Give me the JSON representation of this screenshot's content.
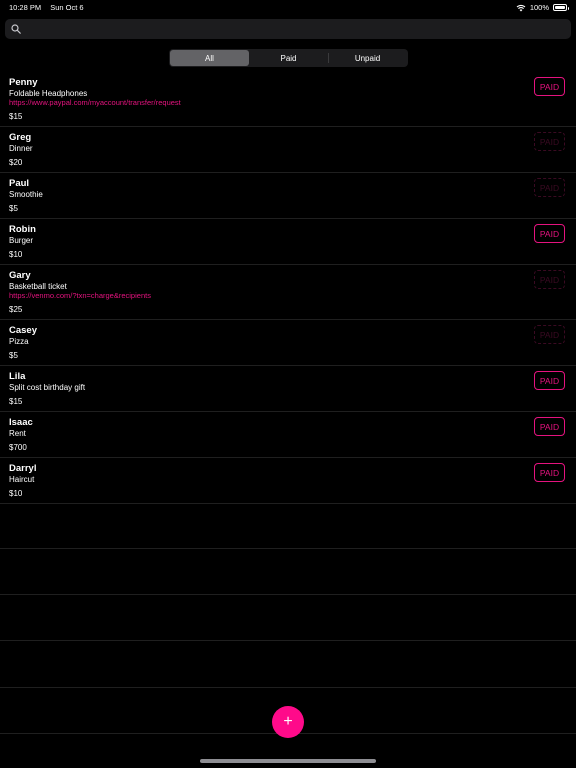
{
  "status": {
    "time": "10:28 PM",
    "date": "Sun Oct 6",
    "battery": "100%"
  },
  "search": {
    "placeholder": ""
  },
  "filter": {
    "options": [
      "All",
      "Paid",
      "Unpaid"
    ],
    "selected": "All"
  },
  "colors": {
    "accent": "#e5137f",
    "fab": "#ff0a8a",
    "background": "#000000"
  },
  "badge_label": "PAID",
  "requests": [
    {
      "name": "Penny",
      "description": "Foldable Headphones",
      "link": "https://www.paypal.com/myaccount/transfer/request",
      "amount": "$15",
      "paid": true
    },
    {
      "name": "Greg",
      "description": "Dinner",
      "link": "",
      "amount": "$20",
      "paid": false
    },
    {
      "name": "Paul",
      "description": "Smoothie",
      "link": "",
      "amount": "$5",
      "paid": false
    },
    {
      "name": "Robin",
      "description": "Burger",
      "link": "",
      "amount": "$10",
      "paid": true
    },
    {
      "name": "Gary",
      "description": "Basketball ticket",
      "link": "https://venmo.com/?txn=charge&recipients",
      "amount": "$25",
      "paid": false
    },
    {
      "name": "Casey",
      "description": "Pizza",
      "link": "",
      "amount": "$5",
      "paid": false
    },
    {
      "name": "Lila",
      "description": "Split cost birthday gift",
      "link": "",
      "amount": "$15",
      "paid": true
    },
    {
      "name": "Isaac",
      "description": "Rent",
      "link": "",
      "amount": "$700",
      "paid": true
    },
    {
      "name": "Darryl",
      "description": "Haircut",
      "link": "",
      "amount": "$10",
      "paid": true
    }
  ],
  "add_button": {
    "label": "+"
  }
}
